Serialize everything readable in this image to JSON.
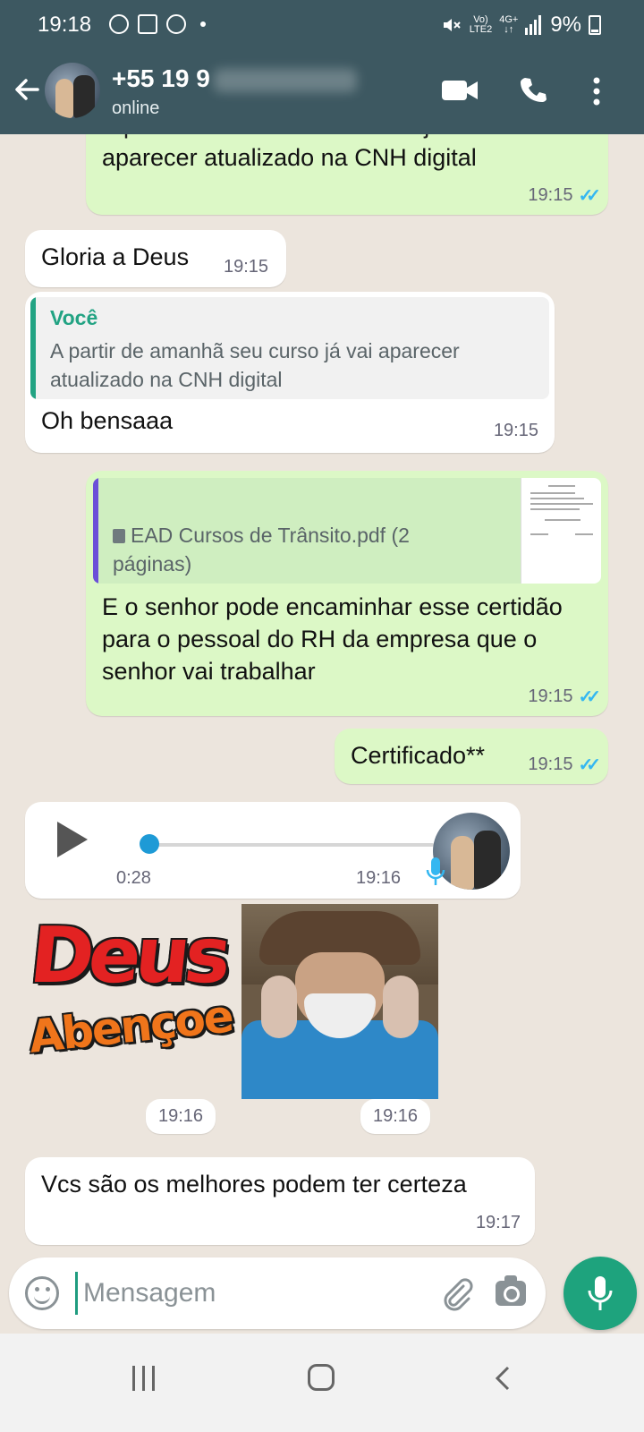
{
  "status_bar": {
    "time": "19:18",
    "network_top": "Vo)",
    "network_bottom": "LTE2",
    "signal_label_top": "4G+",
    "battery": "9%",
    "left_icons": [
      "chrome-icon",
      "news-icon",
      "chrome-icon",
      "dot-icon"
    ]
  },
  "header": {
    "contact_name": "+55 19 9",
    "contact_status": "online"
  },
  "messages": {
    "m1": {
      "text": "aparecer atualizado na CNH digital",
      "partial_text": "A partir de amanhã seu curso já vai",
      "time": "19:15"
    },
    "m2": {
      "text": "Gloria a Deus",
      "time": "19:15"
    },
    "m3": {
      "quote_author": "Você",
      "quote_text": "A partir de amanhã seu curso já vai aparecer atualizado na CNH digital",
      "text": "Oh bensaaa",
      "time": "19:15"
    },
    "m4": {
      "doc_name": "EAD Cursos de Trânsito.pdf (2 páginas)",
      "text": "E o senhor pode encaminhar esse certidão para o pessoal do RH da empresa que o senhor vai trabalhar",
      "time": "19:15"
    },
    "m5": {
      "text": "Certificado**",
      "time": "19:15"
    },
    "m6": {
      "duration": "0:28",
      "time": "19:16"
    },
    "sticker1": {
      "line1": "Deus",
      "line2": "Abençoe",
      "time": "19:16"
    },
    "sticker2": {
      "time": "19:16"
    },
    "m7": {
      "text": "Vcs são os melhores podem ter certeza",
      "time": "19:17"
    }
  },
  "composer": {
    "placeholder": "Mensagem"
  },
  "colors": {
    "header": "#3d5861",
    "outgoing": "#dcf8c6",
    "accent": "#1ea37d",
    "ticks": "#34b7f1"
  }
}
